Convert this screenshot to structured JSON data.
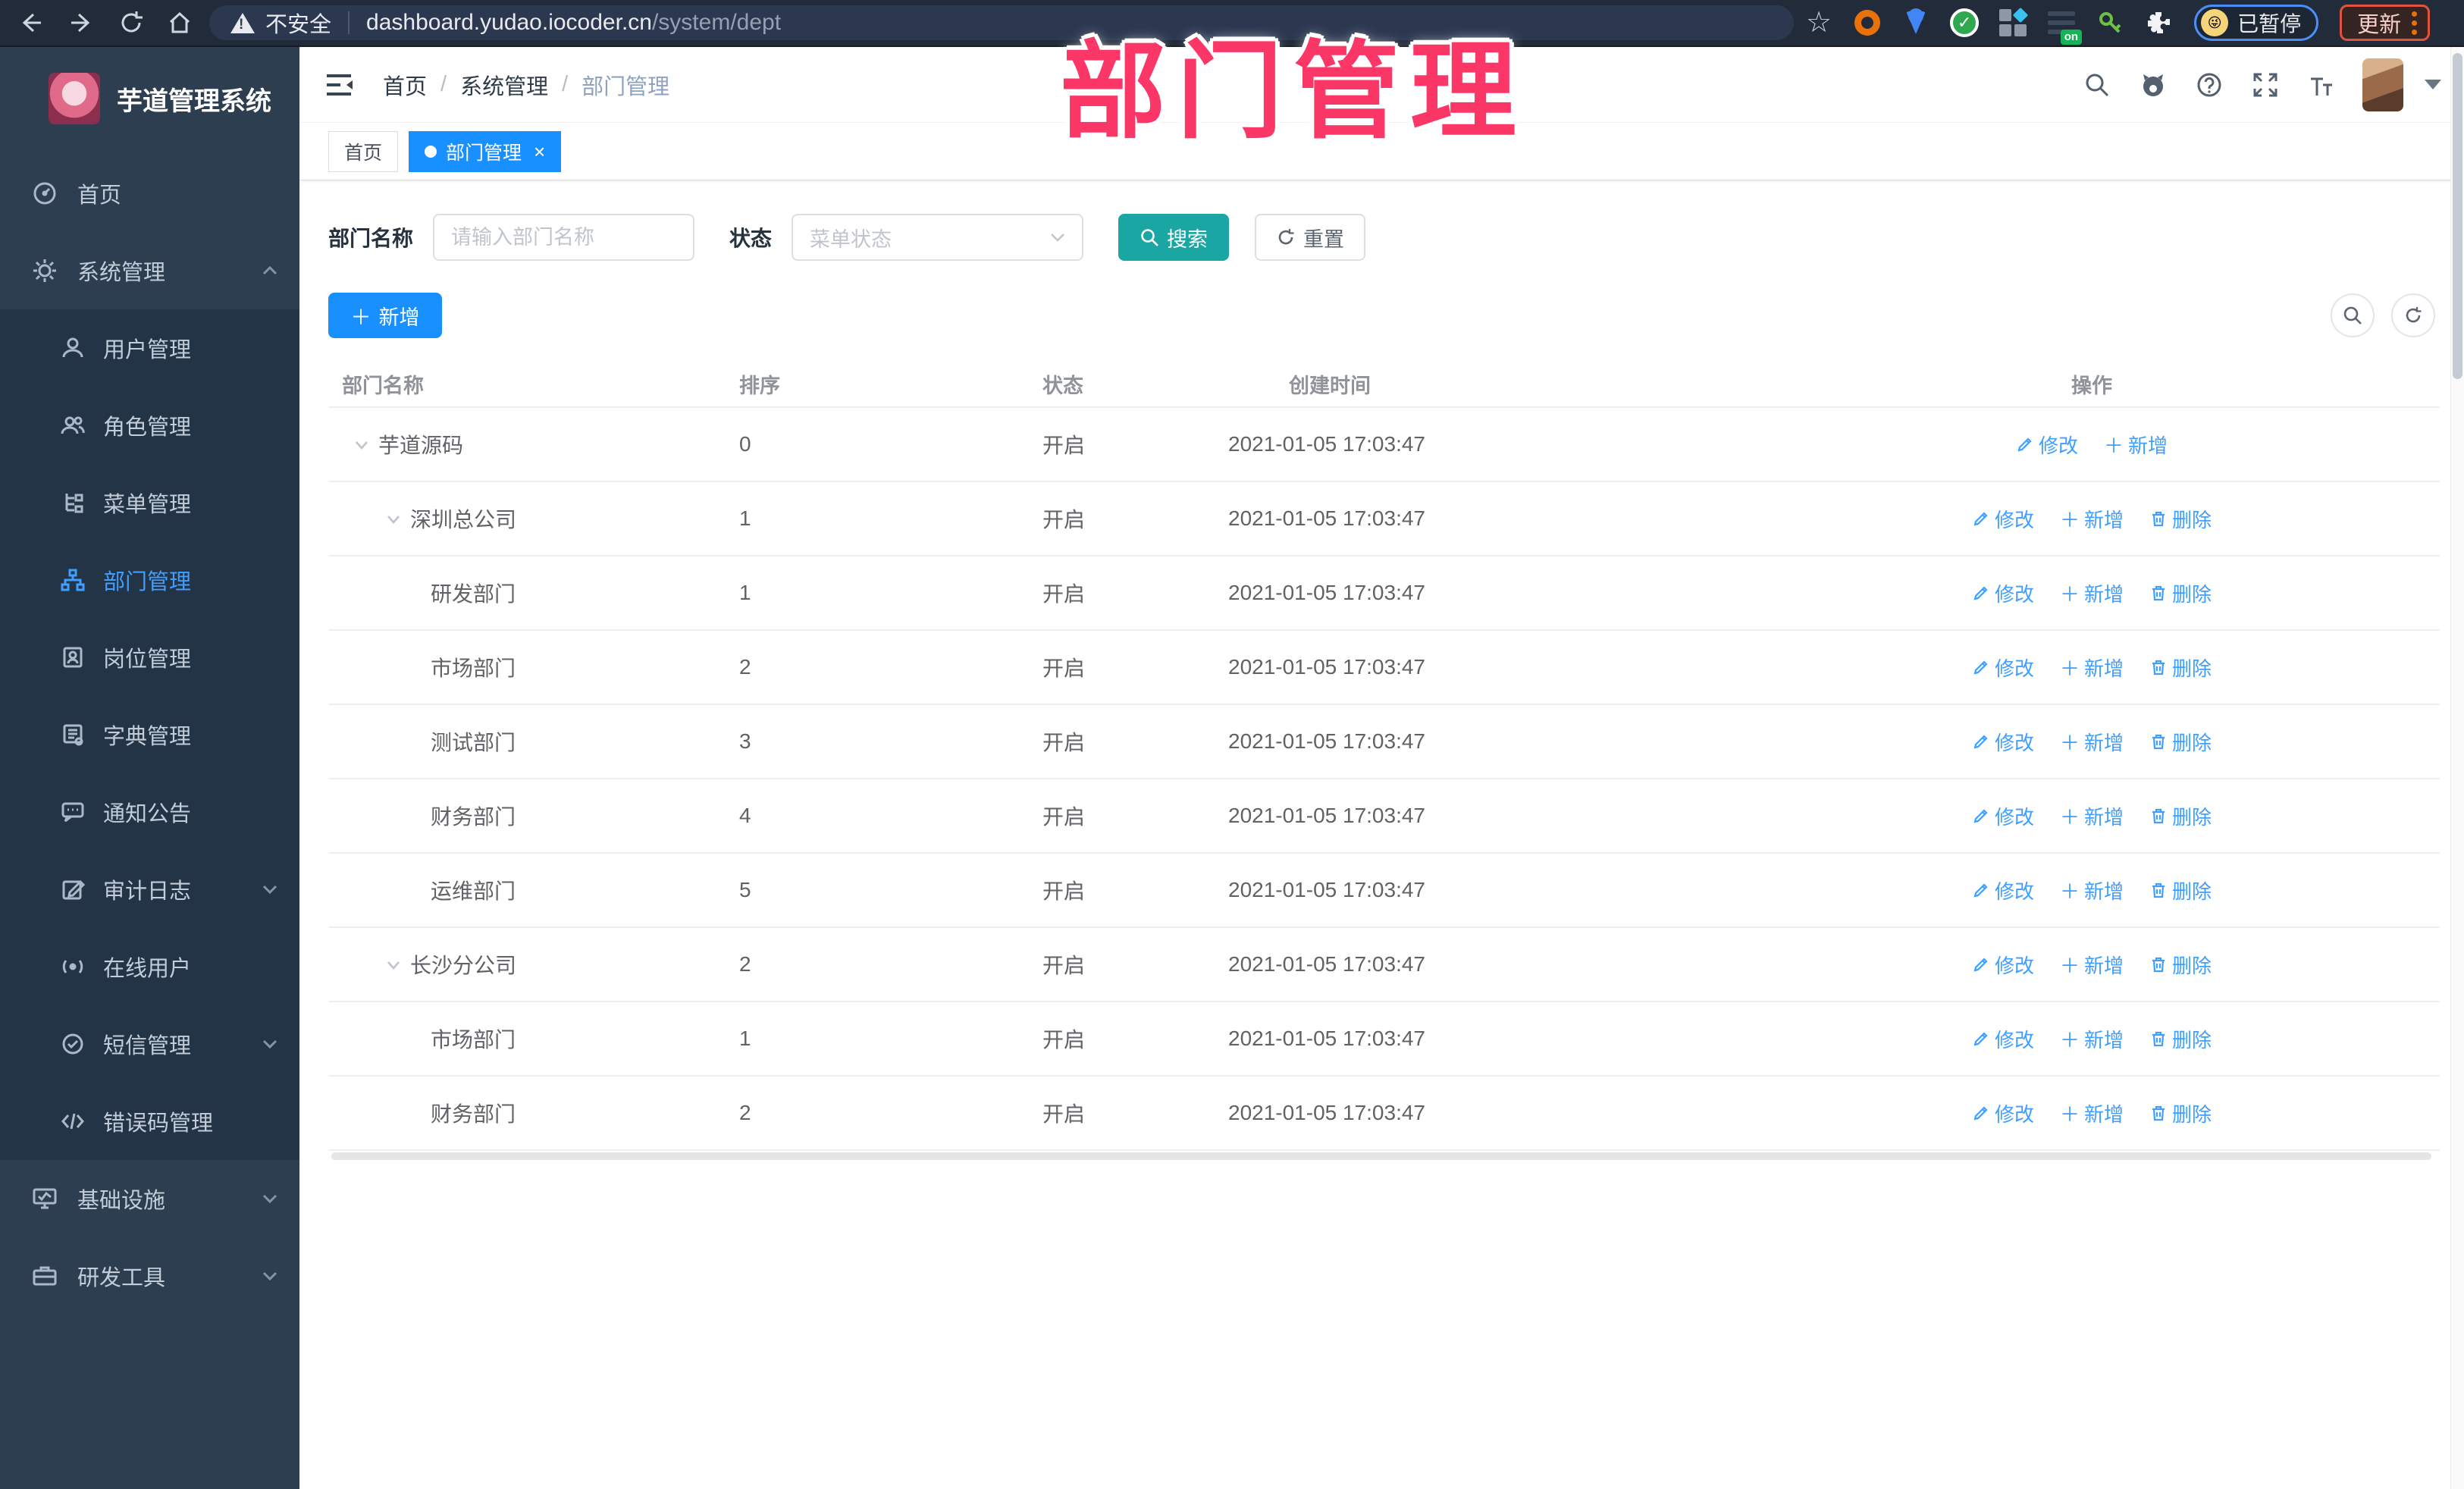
{
  "browser": {
    "security": "不安全",
    "url_host": "dashboard.yudao.iocoder.cn",
    "url_path": "/system/dept",
    "extension_on_badge": "on",
    "profile_status": "已暂停",
    "update_label": "更新"
  },
  "overlay": {
    "title": "部门管理"
  },
  "sidebar": {
    "title": "芋道管理系统",
    "home": "首页",
    "system": "系统管理",
    "infra": "基础设施",
    "devtools": "研发工具",
    "system_children": [
      "用户管理",
      "角色管理",
      "菜单管理",
      "部门管理",
      "岗位管理",
      "字典管理",
      "通知公告",
      "审计日志",
      "在线用户",
      "短信管理",
      "错误码管理"
    ]
  },
  "header": {
    "breadcrumb": [
      "首页",
      "系统管理",
      "部门管理"
    ]
  },
  "tabs": {
    "home": "首页",
    "active": "部门管理"
  },
  "filters": {
    "dept_label": "部门名称",
    "dept_placeholder": "请输入部门名称",
    "status_label": "状态",
    "status_placeholder": "菜单状态",
    "search": "搜索",
    "reset": "重置"
  },
  "toolbar": {
    "add": "新增"
  },
  "table": {
    "headers": [
      "部门名称",
      "排序",
      "状态",
      "创建时间",
      "操作"
    ],
    "actions": {
      "edit": "修改",
      "add": "新增",
      "del": "删除"
    },
    "rows": [
      {
        "name": "芋道源码",
        "sort": 0,
        "status": "开启",
        "created": "2021-01-05 17:03:47"
      },
      {
        "name": "深圳总公司",
        "sort": 1,
        "status": "开启",
        "created": "2021-01-05 17:03:47"
      },
      {
        "name": "研发部门",
        "sort": 1,
        "status": "开启",
        "created": "2021-01-05 17:03:47"
      },
      {
        "name": "市场部门",
        "sort": 2,
        "status": "开启",
        "created": "2021-01-05 17:03:47"
      },
      {
        "name": "测试部门",
        "sort": 3,
        "status": "开启",
        "created": "2021-01-05 17:03:47"
      },
      {
        "name": "财务部门",
        "sort": 4,
        "status": "开启",
        "created": "2021-01-05 17:03:47"
      },
      {
        "name": "运维部门",
        "sort": 5,
        "status": "开启",
        "created": "2021-01-05 17:03:47"
      },
      {
        "name": "长沙分公司",
        "sort": 2,
        "status": "开启",
        "created": "2021-01-05 17:03:47"
      },
      {
        "name": "市场部门",
        "sort": 1,
        "status": "开启",
        "created": "2021-01-05 17:03:47"
      },
      {
        "name": "财务部门",
        "sort": 2,
        "status": "开启",
        "created": "2021-01-05 17:03:47"
      }
    ]
  },
  "colors": {
    "accent_blue": "#1890ff",
    "link_blue": "#409eff",
    "teal": "#1aa6a3",
    "sidebar_bg": "#2d3e50",
    "submenu_bg": "#233446",
    "overlay_pink": "#fa3766"
  }
}
